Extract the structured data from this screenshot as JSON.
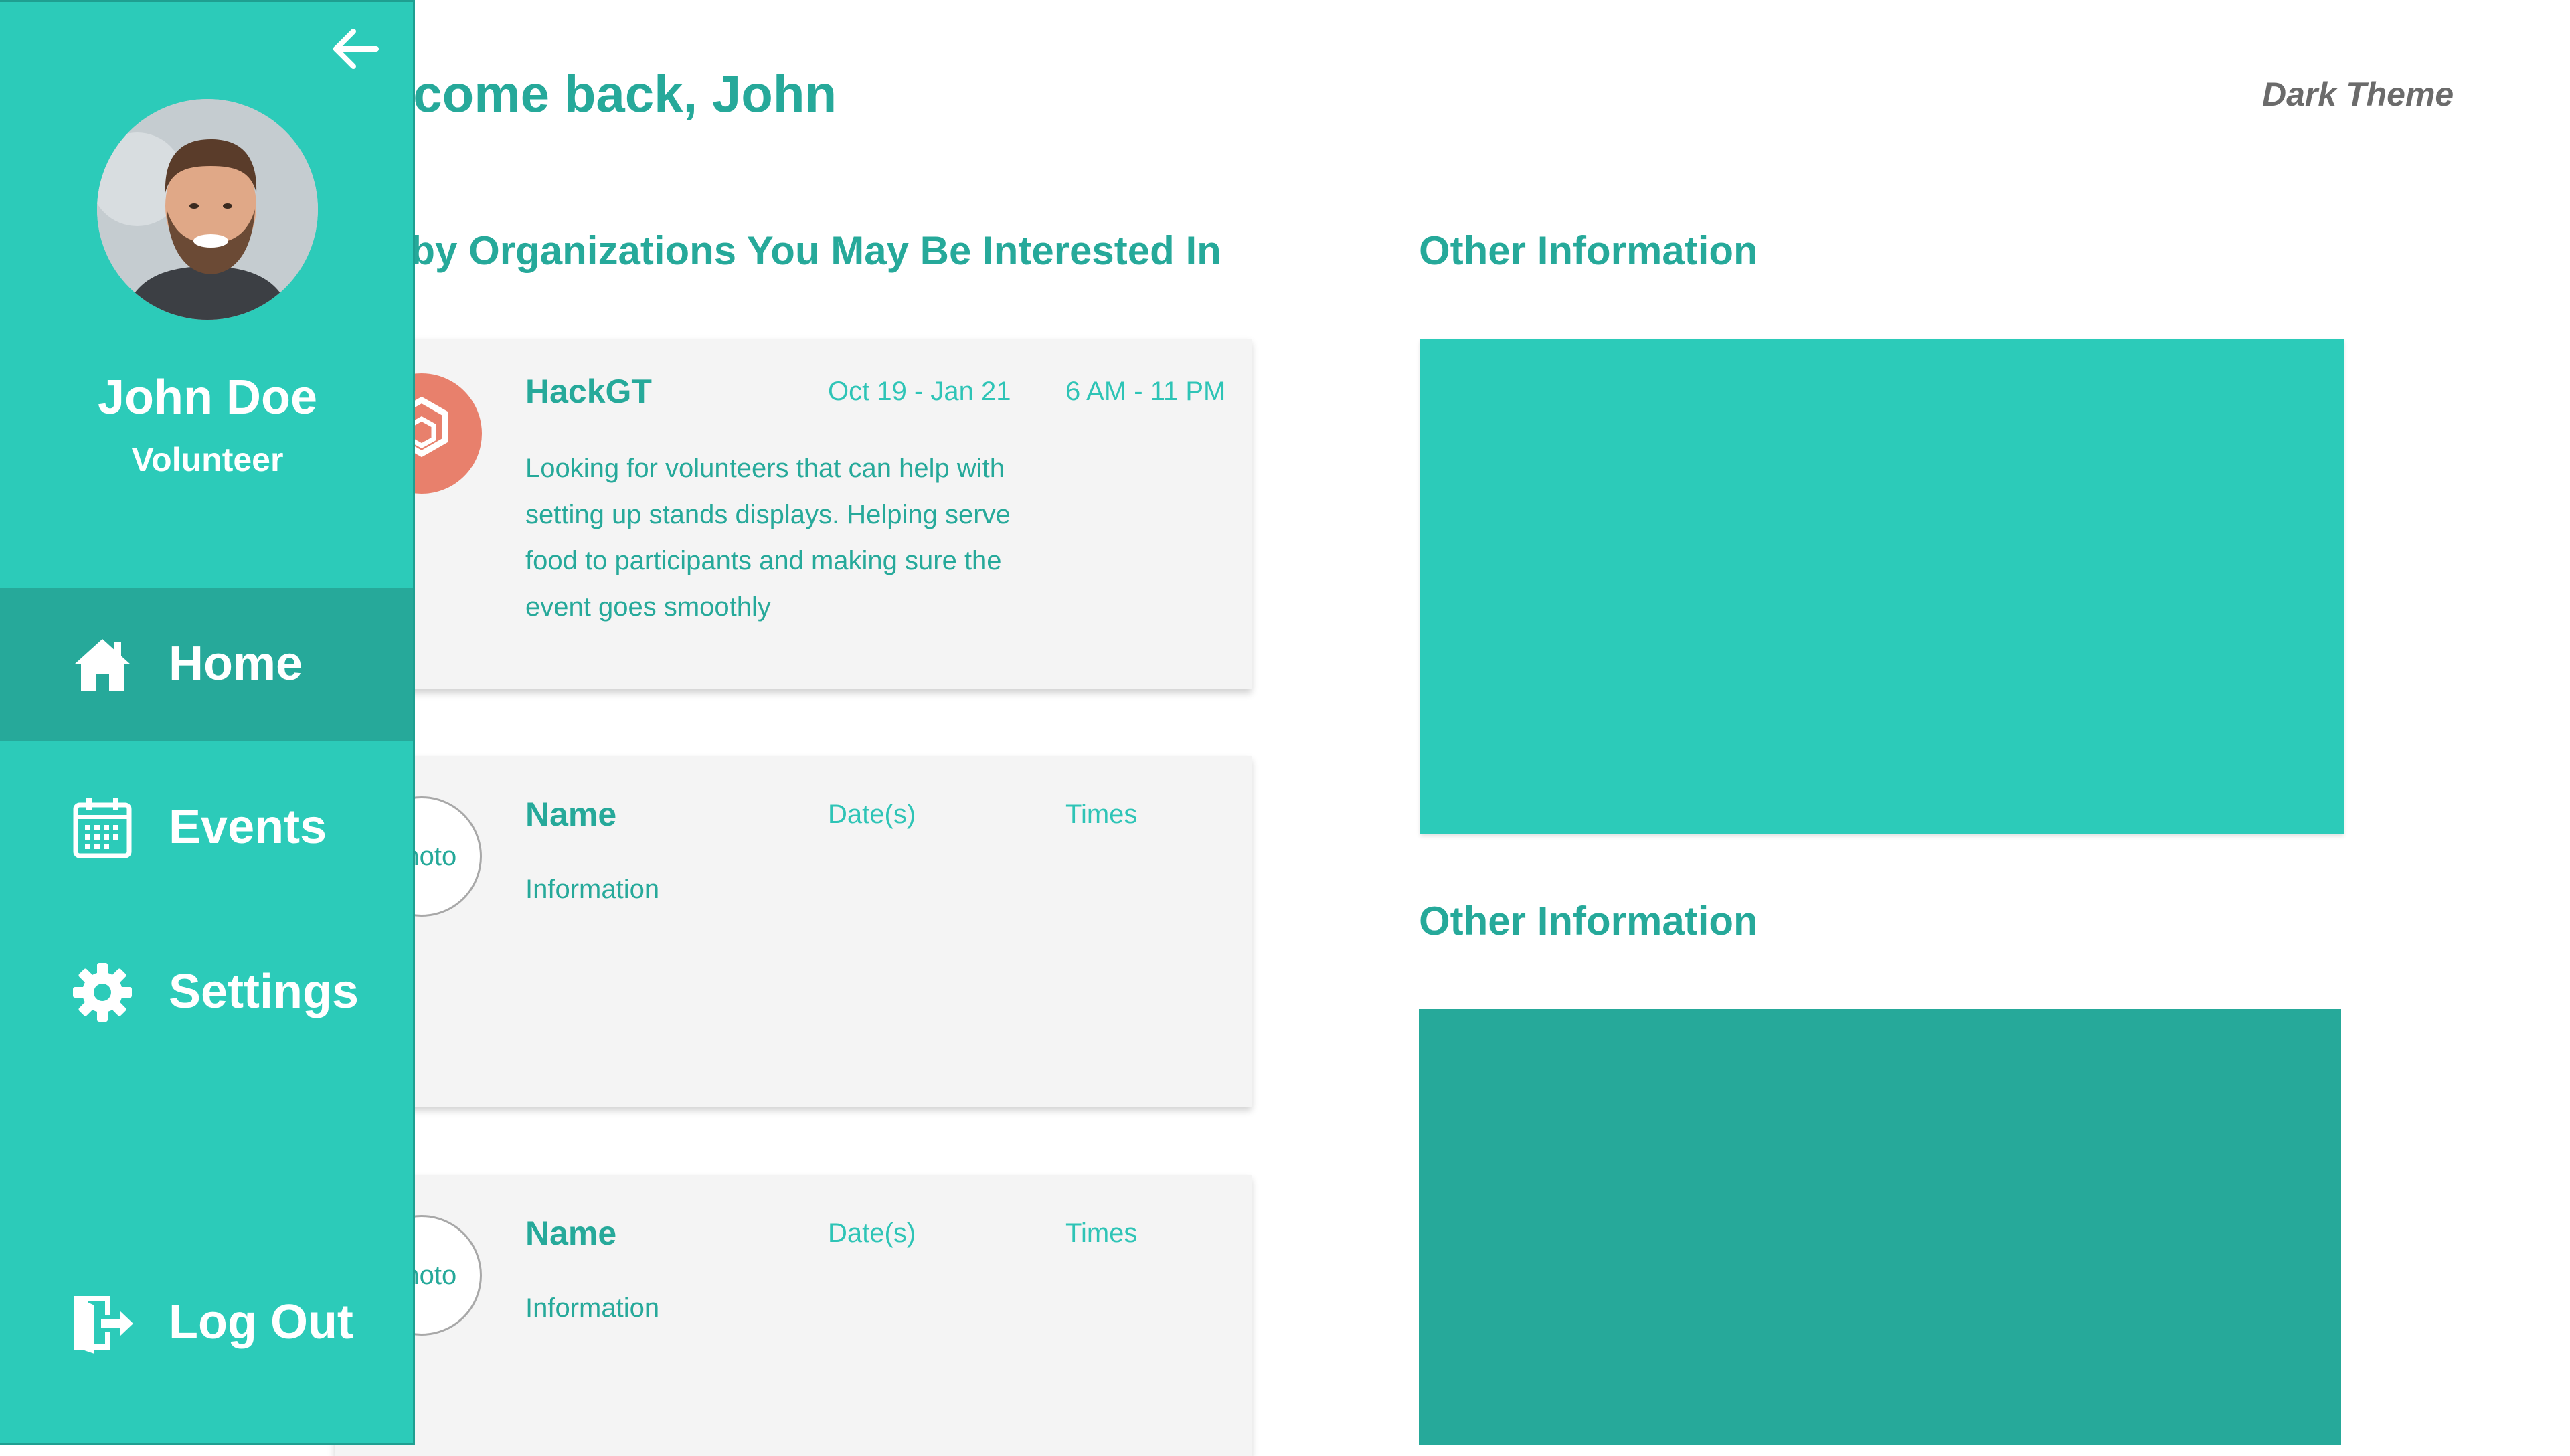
{
  "header": {
    "welcome": "Welcome back, John",
    "theme_toggle": "Dark Theme"
  },
  "sections": {
    "nearby_title": "Nearby Organizations You May Be Interested In",
    "other_title_1": "Other Information",
    "other_title_2": "Other Information"
  },
  "cards": [
    {
      "name": "HackGT",
      "dates": "Oct 19 - Jan 21",
      "times": "6 AM - 11 PM",
      "info": "Looking for volunteers that can help with setting up stands displays. Helping serve food to participants and making sure the event goes smoothly"
    },
    {
      "photo_label": "Photo",
      "name": "Name",
      "dates": "Date(s)",
      "times": "Times",
      "info": "Information"
    },
    {
      "photo_label": "Photo",
      "name": "Name",
      "dates": "Date(s)",
      "times": "Times",
      "info": "Information"
    }
  ],
  "sidebar": {
    "user_name": "John Doe",
    "user_role": "Volunteer",
    "nav": [
      {
        "label": "Home",
        "icon": "home-icon",
        "active": true
      },
      {
        "label": "Events",
        "icon": "calendar-icon",
        "active": false
      },
      {
        "label": "Settings",
        "icon": "gear-icon",
        "active": false
      }
    ],
    "logout_label": "Log Out"
  },
  "colors": {
    "teal": "#2ccbb9",
    "teal_dark": "#26a99a",
    "hackgt_logo": "#e8806c",
    "panel_bg": "#f4f4f4"
  }
}
